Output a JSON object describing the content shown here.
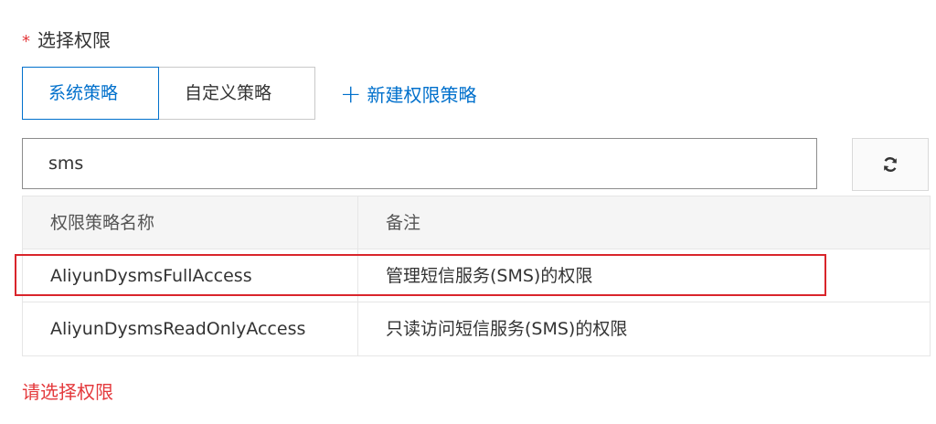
{
  "field": {
    "required_mark": "*",
    "label": "选择权限"
  },
  "tabs": [
    {
      "label": "系统策略",
      "active": true
    },
    {
      "label": "自定义策略",
      "active": false
    }
  ],
  "new_policy_link": {
    "icon": "plus-icon",
    "label": "新建权限策略"
  },
  "search": {
    "value": "sms",
    "placeholder": ""
  },
  "refresh_button": {
    "icon": "refresh-icon"
  },
  "table": {
    "columns": [
      "权限策略名称",
      "备注"
    ],
    "rows": [
      {
        "name": "AliyunDysmsFullAccess",
        "note": "管理短信服务(SMS)的权限",
        "highlighted": true
      },
      {
        "name": "AliyunDysmsReadOnlyAccess",
        "note": "只读访问短信服务(SMS)的权限",
        "highlighted": false
      }
    ]
  },
  "validation_message": "请选择权限",
  "colors": {
    "accent": "#0070cc",
    "error": "#e4393c",
    "highlight_box": "#d9252b"
  }
}
